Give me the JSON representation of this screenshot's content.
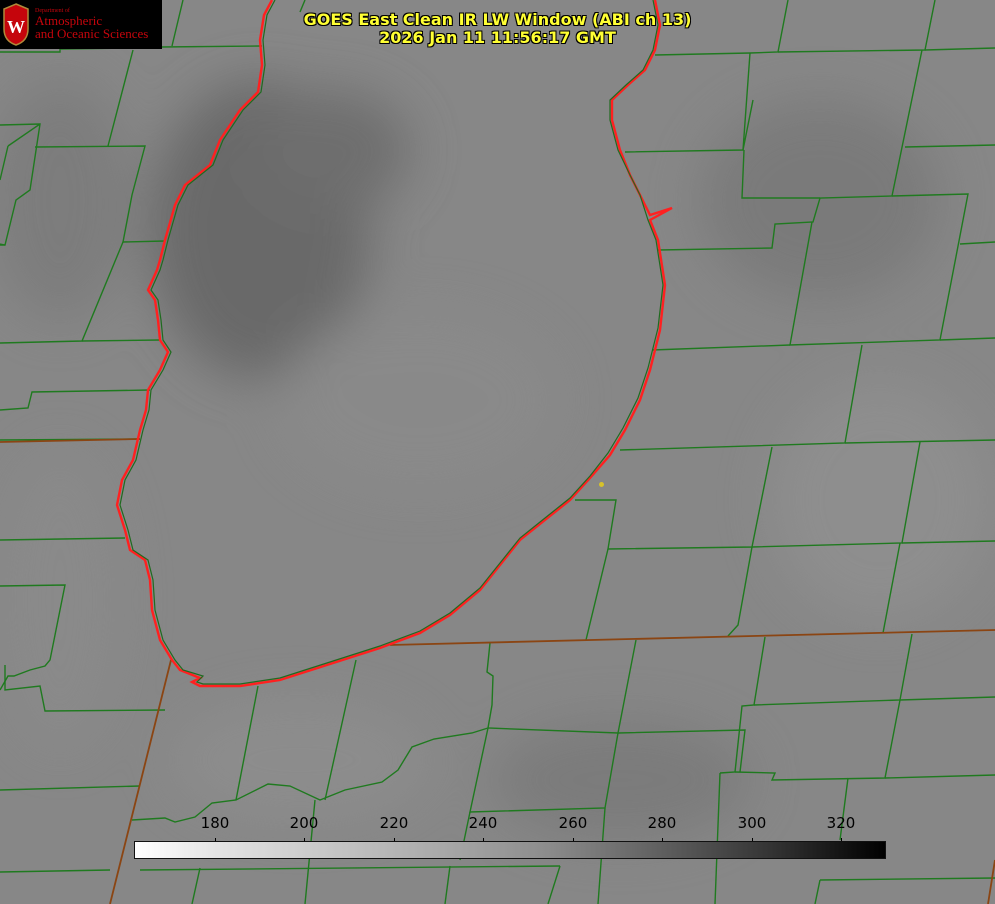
{
  "title": {
    "line1": "GOES East Clean IR LW Window (ABI ch 13)",
    "line2": "2026 Jan 11 11:56:17 GMT"
  },
  "logo": {
    "dept": "Department of",
    "name_line1": "Atmospheric",
    "name_line2": "and Oceanic Sciences",
    "crest_letter": "W"
  },
  "colorbar": {
    "ticks": [
      "180",
      "200",
      "220",
      "240",
      "260",
      "280",
      "300",
      "320"
    ],
    "colors": {
      "min": "#ffffff",
      "max": "#000000"
    }
  },
  "colors": {
    "county_lines": "#1f7a1f",
    "state_lines": "#8b4513",
    "coastline": "#ff2020",
    "title_text": "#ffff33",
    "station_dot": "#d7c22a"
  }
}
